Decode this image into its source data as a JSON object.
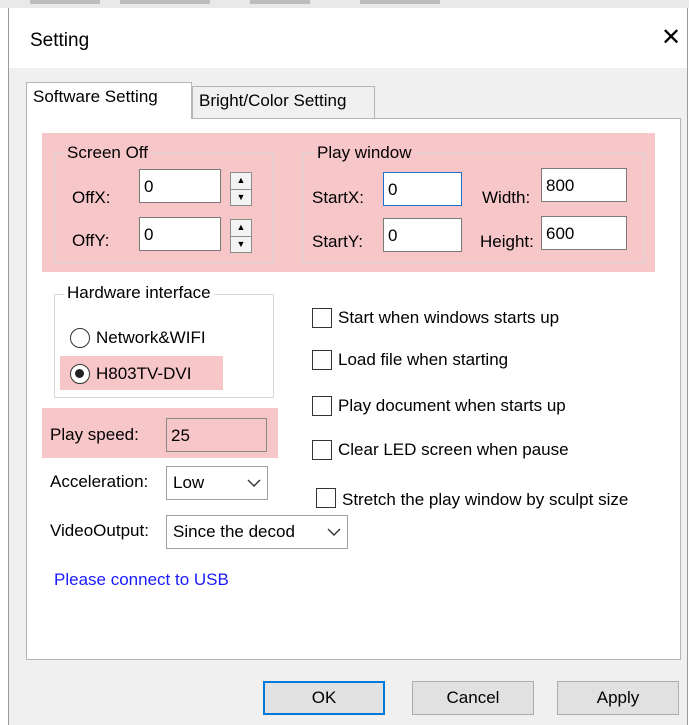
{
  "window": {
    "title": "Setting",
    "close_glyph": "✕"
  },
  "tabs": [
    {
      "label": "Software Setting",
      "active": true
    },
    {
      "label": "Bright/Color Setting",
      "active": false
    }
  ],
  "screen_off": {
    "title": "Screen Off",
    "offx_label": "OffX:",
    "offx_value": "0",
    "offy_label": "OffY:",
    "offy_value": "0"
  },
  "play_window": {
    "title": "Play window",
    "startx_label": "StartX:",
    "startx_value": "0",
    "starty_label": "StartY:",
    "starty_value": "0",
    "width_label": "Width:",
    "width_value": "800",
    "height_label": "Height:",
    "height_value": "600"
  },
  "hardware_interface": {
    "title": "Hardware interface",
    "options": [
      {
        "label": "Network&WIFI",
        "selected": false
      },
      {
        "label": "H803TV-DVI",
        "selected": true
      }
    ]
  },
  "play_speed": {
    "label": "Play speed:",
    "value": "25"
  },
  "acceleration": {
    "label": "Acceleration:",
    "value": "Low"
  },
  "video_output": {
    "label": "VideoOutput:",
    "value": "Since the decod"
  },
  "status_text": "Please connect to USB",
  "checkboxes": [
    {
      "label": "Start when windows starts up",
      "checked": false
    },
    {
      "label": "Load file when starting",
      "checked": false
    },
    {
      "label": "Play document when starts up",
      "checked": false
    },
    {
      "label": "Clear LED screen when pause",
      "checked": false
    },
    {
      "label": "Stretch the play window by  sculpt size",
      "checked": false
    }
  ],
  "buttons": {
    "ok": "OK",
    "cancel": "Cancel",
    "apply": "Apply"
  },
  "colors": {
    "highlight": "#f7c6c8",
    "focus_border": "#1f6fd1",
    "link": "#1a1aff",
    "default_button_border": "#0078d7"
  }
}
